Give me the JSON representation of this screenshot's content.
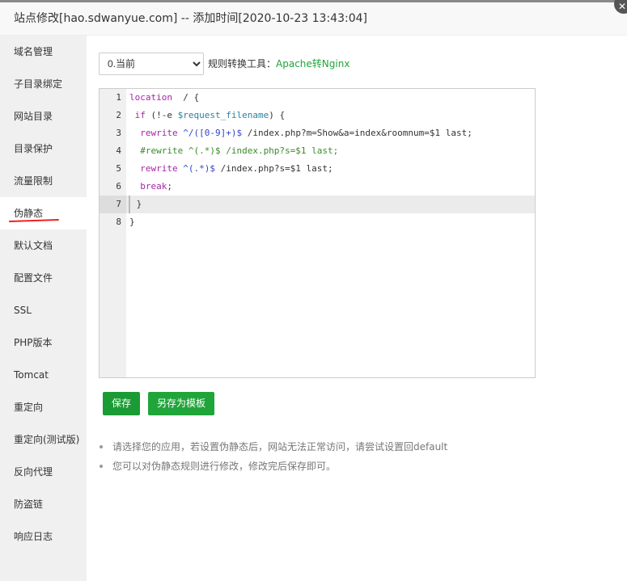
{
  "window": {
    "title": "站点修改[hao.sdwanyue.com] -- 添加时间[2020-10-23 13:43:04]",
    "close_icon": "close-icon"
  },
  "sidebar": {
    "active_index": 5,
    "items": [
      {
        "label": "域名管理"
      },
      {
        "label": "子目录绑定"
      },
      {
        "label": "网站目录"
      },
      {
        "label": "目录保护"
      },
      {
        "label": "流量限制"
      },
      {
        "label": "伪静态"
      },
      {
        "label": "默认文档"
      },
      {
        "label": "配置文件"
      },
      {
        "label": "SSL"
      },
      {
        "label": "PHP版本"
      },
      {
        "label": "Tomcat"
      },
      {
        "label": "重定向"
      },
      {
        "label": "重定向(测试版)"
      },
      {
        "label": "反向代理"
      },
      {
        "label": "防盗链"
      },
      {
        "label": "响应日志"
      }
    ]
  },
  "main": {
    "template_select": {
      "value": "0.当前"
    },
    "tool_label": "规则转换工具：",
    "tool_link": "Apache转Nginx",
    "editor": {
      "current_line": 7,
      "lines": [
        {
          "n": "1",
          "parts": [
            [
              "kw",
              "location"
            ],
            [
              "",
              "  / {"
            ]
          ]
        },
        {
          "n": "2",
          "parts": [
            [
              "",
              ""
            ],
            [
              "kw",
              " if"
            ],
            [
              "",
              " (!-e "
            ],
            [
              "vr",
              "$request_filename"
            ],
            [
              "",
              ") {"
            ]
          ]
        },
        {
          "n": "3",
          "parts": [
            [
              "kw",
              "  rewrite"
            ],
            [
              "rx",
              " ^/([0-9]+)$"
            ],
            [
              "",
              " /index.php?m=Show&a=index&roomnum=$1 last;"
            ]
          ]
        },
        {
          "n": "4",
          "parts": [
            [
              "cm",
              "  #rewrite ^(.*)$ /index.php?s=$1 last;"
            ]
          ]
        },
        {
          "n": "5",
          "parts": [
            [
              "kw",
              "  rewrite"
            ],
            [
              "rx",
              " ^(.*)$"
            ],
            [
              "",
              " /index.php?s=$1 last;"
            ]
          ]
        },
        {
          "n": "6",
          "parts": [
            [
              "kw",
              "  break"
            ],
            [
              "",
              ";"
            ]
          ]
        },
        {
          "n": "7",
          "parts": [
            [
              "",
              " }"
            ]
          ]
        },
        {
          "n": "8",
          "parts": [
            [
              "",
              "}"
            ]
          ]
        }
      ]
    },
    "save_label": "保存",
    "save_template_label": "另存为模板",
    "tips": [
      "请选择您的应用，若设置伪静态后，网站无法正常访问，请尝试设置回default",
      "您可以对伪静态规则进行修改，修改完后保存即可。"
    ]
  },
  "colors": {
    "accent": "#20a53a",
    "active_underline": "#e22222"
  }
}
